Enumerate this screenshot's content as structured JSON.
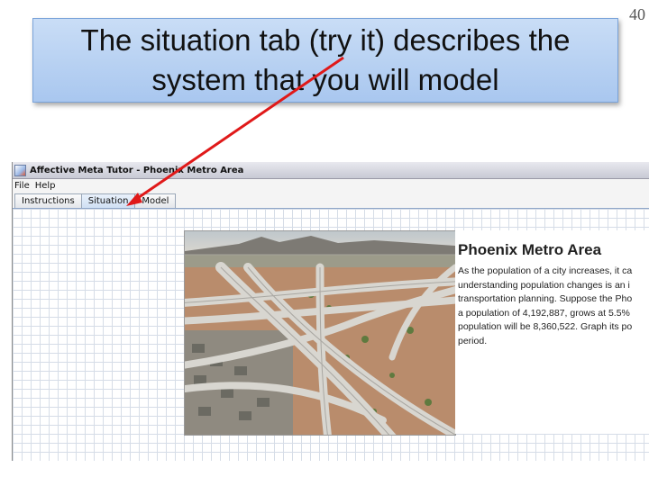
{
  "slide": {
    "number": "40",
    "callout_line1": "The situation tab (try it) describes the",
    "callout_line2": "system that you will model"
  },
  "app": {
    "window_title": "Affective Meta Tutor - Phoenix Metro Area",
    "menu": [
      "File",
      "Help"
    ],
    "tabs": [
      {
        "label": "Instructions",
        "active": false
      },
      {
        "label": "Situation",
        "active": true
      },
      {
        "label": "Model",
        "active": false
      }
    ],
    "situation": {
      "title": "Phoenix Metro Area",
      "description_lines": [
        "As the population of a city increases, it ca",
        "understanding population changes is an i",
        "transportation planning. Suppose the Pho",
        "a population of 4,192,887, grows at 5.5%",
        "population will be 8,360,522. Graph its po",
        "period."
      ]
    }
  },
  "colors": {
    "callout_fill": "#b9d3f3",
    "arrow": "#e01919",
    "grid": "#d6dde7"
  }
}
